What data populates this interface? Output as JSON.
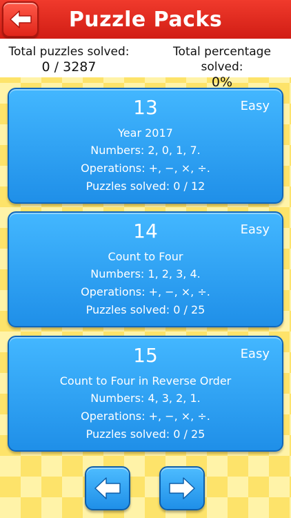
{
  "header": {
    "title": "Puzzle Packs",
    "back_icon": "arrow-left-icon"
  },
  "stats": {
    "solved_label": "Total puzzles solved:",
    "solved_value": "0 / 3287",
    "percent_label": "Total percentage solved:",
    "percent_value": "0%"
  },
  "packs": [
    {
      "number": "13",
      "difficulty": "Easy",
      "title": "Year 2017",
      "numbers": "Numbers: 2, 0, 1, 7.",
      "operations": "Operations: +, −, ×, ÷.",
      "solved": "Puzzles solved: 0 / 12"
    },
    {
      "number": "14",
      "difficulty": "Easy",
      "title": "Count to Four",
      "numbers": "Numbers: 1, 2, 3, 4.",
      "operations": "Operations: +, −, ×, ÷.",
      "solved": "Puzzles solved: 0 / 25"
    },
    {
      "number": "15",
      "difficulty": "Easy",
      "title": "Count to Four in Reverse Order",
      "numbers": "Numbers: 4, 3, 2, 1.",
      "operations": "Operations: +, −, ×, ÷.",
      "solved": "Puzzles solved: 0 / 25"
    }
  ],
  "nav": {
    "prev_icon": "arrow-left-icon",
    "next_icon": "arrow-right-icon"
  },
  "colors": {
    "header": "#e12a1f",
    "card": "#2b9cf0",
    "background": "#fde36a"
  }
}
